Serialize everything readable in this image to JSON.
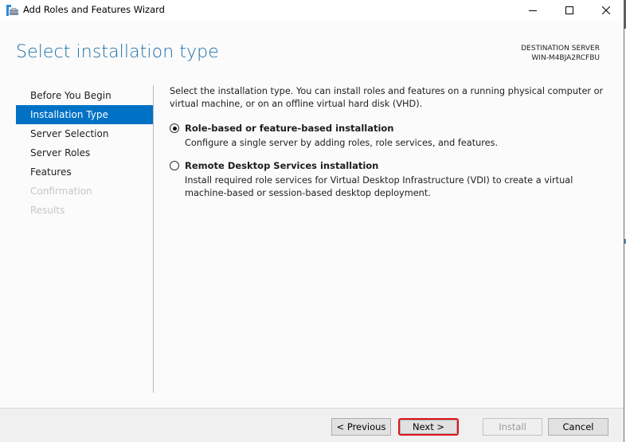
{
  "window": {
    "title": "Add Roles and Features Wizard",
    "icon": "server-manager-wizard-icon",
    "controls": {
      "minimize": "minimize-icon",
      "maximize": "maximize-icon",
      "close": "close-icon"
    }
  },
  "header": {
    "title": "Select installation type",
    "destination_label": "DESTINATION SERVER",
    "destination_server": "WIN-M4BJA2RCFBU"
  },
  "sidebar": {
    "items": [
      {
        "label": "Before You Begin",
        "state": "normal"
      },
      {
        "label": "Installation Type",
        "state": "active"
      },
      {
        "label": "Server Selection",
        "state": "normal"
      },
      {
        "label": "Server Roles",
        "state": "normal"
      },
      {
        "label": "Features",
        "state": "normal"
      },
      {
        "label": "Confirmation",
        "state": "disabled"
      },
      {
        "label": "Results",
        "state": "disabled"
      }
    ]
  },
  "content": {
    "intro": "Select the installation type. You can install roles and features on a running physical computer or virtual machine, or on an offline virtual hard disk (VHD).",
    "options": [
      {
        "title": "Role-based or feature-based installation",
        "description": "Configure a single server by adding roles, role services, and features.",
        "selected": true
      },
      {
        "title": "Remote Desktop Services installation",
        "description": "Install required role services for Virtual Desktop Infrastructure (VDI) to create a virtual machine-based or session-based desktop deployment.",
        "selected": false
      }
    ]
  },
  "footer": {
    "previous_label": "< Previous",
    "next_label": "Next >",
    "install_label": "Install",
    "cancel_label": "Cancel",
    "install_enabled": false,
    "highlight_color": "#e0141e"
  },
  "colors": {
    "accent": "#0072c6",
    "title": "#1f6fa8",
    "disabled_text": "#c6c6c6"
  }
}
